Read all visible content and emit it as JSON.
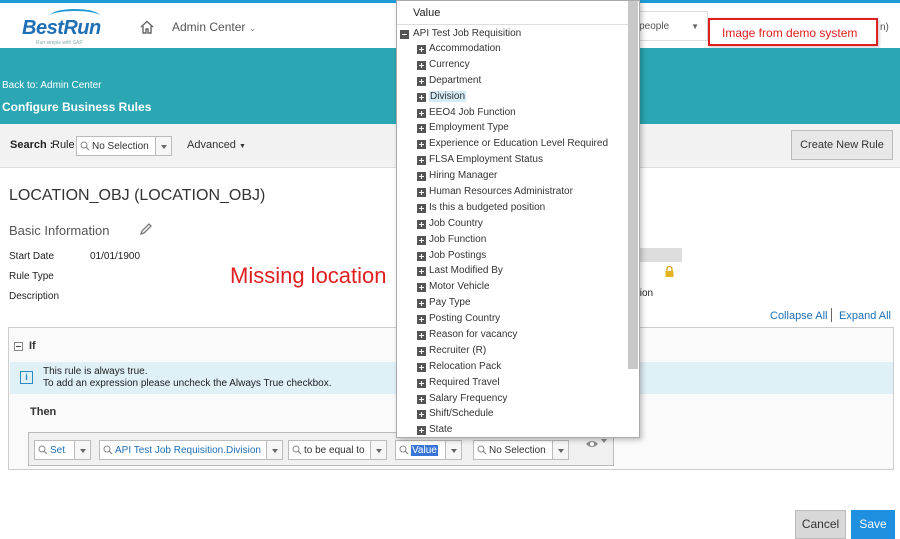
{
  "header": {
    "brand": "BestRun",
    "brand_tagline": "Run simple with SAP",
    "admin_center_label": "Admin Center",
    "search_scope": "r people",
    "demo_notice": "Image from demo system",
    "right_fragment": "n)"
  },
  "banner": {
    "back_link": "Back to: Admin Center",
    "title": "Configure Business Rules"
  },
  "search": {
    "label": "Search :",
    "rule_label": "Rule",
    "rule_value": "No Selection",
    "advanced_label": "Advanced",
    "create_button": "Create New Rule"
  },
  "rule": {
    "title": "LOCATION_OBJ (LOCATION_OBJ)",
    "section_title": "Basic Information",
    "start_date_label": "Start Date",
    "start_date_value": "01/01/1900",
    "rule_type_label": "Rule Type",
    "description_label": "Description",
    "right_partial": "tion"
  },
  "annotation": "Missing location",
  "controls": {
    "collapse_all": "Collapse All",
    "expand_all": "Expand All"
  },
  "if_block": {
    "label": "If",
    "info_line1": "This rule is always true.",
    "info_line2": "To add an expression please uncheck the Always True checkbox."
  },
  "then_block": {
    "label": "Then",
    "action": "Set",
    "field": "API Test Job Requisition.Division",
    "operator": "to be equal to",
    "value_type": "Value",
    "value_selection": "No Selection"
  },
  "footer": {
    "cancel": "Cancel",
    "save": "Save"
  },
  "dropdown": {
    "header": "Value",
    "root": "API Test Job Requisition",
    "items": [
      "Accommodation",
      "Currency",
      "Department",
      "Division",
      "EEO4 Job Function",
      "Employment Type",
      "Experience or Education Level Required",
      "FLSA Employment Status",
      "Hiring Manager",
      "Human Resources Administrator",
      "Is this a budgeted position",
      "Job Country",
      "Job Function",
      "Job Postings",
      "Last Modified By",
      "Motor Vehicle",
      "Pay Type",
      "Posting Country",
      "Reason for vacancy",
      "Recruiter (R)",
      "Relocation Pack",
      "Required Travel",
      "Salary Frequency",
      "Shift/Schedule",
      "State"
    ],
    "highlighted": "Division"
  },
  "colors": {
    "banner": "#2ba6b3",
    "accent_blue": "#1e9bd7",
    "save_button": "#1f8fe0",
    "annotation_red": "#e02020"
  }
}
